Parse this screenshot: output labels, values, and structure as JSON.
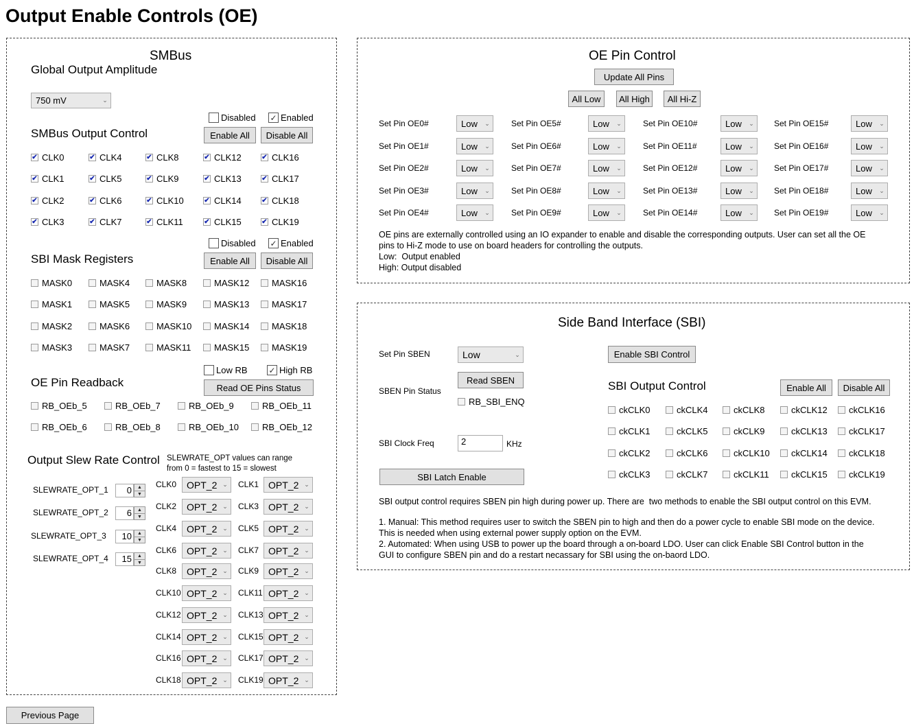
{
  "page_title": "Output Enable Controls (OE)",
  "smbus": {
    "title": "SMBus",
    "global_amp_label": "Global Output Amplitude",
    "global_amp_value": "750 mV",
    "output_control": {
      "title": "SMBus Output Control",
      "disabled_label": "Disabled",
      "enabled_label": "Enabled",
      "disabled_checked": false,
      "enabled_checked": true,
      "enable_all": "Enable All",
      "disable_all": "Disable All",
      "columns": [
        [
          "CLK0",
          "CLK1",
          "CLK2",
          "CLK3"
        ],
        [
          "CLK4",
          "CLK5",
          "CLK6",
          "CLK7"
        ],
        [
          "CLK8",
          "CLK9",
          "CLK10",
          "CLK11"
        ],
        [
          "CLK12",
          "CLK13",
          "CLK14",
          "CLK15"
        ],
        [
          "CLK16",
          "CLK17",
          "CLK18",
          "CLK19"
        ]
      ],
      "all_checked": true
    },
    "mask": {
      "title": "SBI Mask Registers",
      "disabled_label": "Disabled",
      "enabled_label": "Enabled",
      "disabled_checked": false,
      "enabled_checked": true,
      "enable_all": "Enable All",
      "disable_all": "Disable All",
      "columns": [
        [
          "MASK0",
          "MASK1",
          "MASK2",
          "MASK3"
        ],
        [
          "MASK4",
          "MASK5",
          "MASK6",
          "MASK7"
        ],
        [
          "MASK8",
          "MASK9",
          "MASK10",
          "MASK11"
        ],
        [
          "MASK12",
          "MASK13",
          "MASK14",
          "MASK15"
        ],
        [
          "MASK16",
          "MASK17",
          "MASK18",
          "MASK19"
        ]
      ],
      "all_checked": false
    },
    "readback": {
      "title": "OE Pin Readback",
      "low_rb_label": "Low RB",
      "high_rb_label": "High RB",
      "low_rb_checked": false,
      "high_rb_checked": true,
      "read_button": "Read OE Pins Status",
      "columns": [
        [
          "RB_OEb_5",
          "RB_OEb_6"
        ],
        [
          "RB_OEb_7",
          "RB_OEb_8"
        ],
        [
          "RB_OEb_9",
          "RB_OEb_10"
        ],
        [
          "RB_OEb_11",
          "RB_OEb_12"
        ]
      ]
    },
    "slew": {
      "title": "Output Slew Rate Control",
      "note_line1": "SLEWRATE_OPT values can range",
      "note_line2": "from 0 = fastest to 15 = slowest",
      "options": [
        {
          "label": "SLEWRATE_OPT_1",
          "value": "0"
        },
        {
          "label": "SLEWRATE_OPT_2",
          "value": "6"
        },
        {
          "label": "SLEWRATE_OPT_3",
          "value": "10"
        },
        {
          "label": "SLEWRATE_OPT_4",
          "value": "15"
        }
      ],
      "clocks": [
        {
          "label": "CLK0",
          "value": "OPT_2"
        },
        {
          "label": "CLK1",
          "value": "OPT_2"
        },
        {
          "label": "CLK2",
          "value": "OPT_2"
        },
        {
          "label": "CLK3",
          "value": "OPT_2"
        },
        {
          "label": "CLK4",
          "value": "OPT_2"
        },
        {
          "label": "CLK5",
          "value": "OPT_2"
        },
        {
          "label": "CLK6",
          "value": "OPT_2"
        },
        {
          "label": "CLK7",
          "value": "OPT_2"
        },
        {
          "label": "CLK8",
          "value": "OPT_2"
        },
        {
          "label": "CLK9",
          "value": "OPT_2"
        },
        {
          "label": "CLK10",
          "value": "OPT_2"
        },
        {
          "label": "CLK11",
          "value": "OPT_2"
        },
        {
          "label": "CLK12",
          "value": "OPT_2"
        },
        {
          "label": "CLK13",
          "value": "OPT_2"
        },
        {
          "label": "CLK14",
          "value": "OPT_2"
        },
        {
          "label": "CLK15",
          "value": "OPT_2"
        },
        {
          "label": "CLK16",
          "value": "OPT_2"
        },
        {
          "label": "CLK17",
          "value": "OPT_2"
        },
        {
          "label": "CLK18",
          "value": "OPT_2"
        },
        {
          "label": "CLK19",
          "value": "OPT_2"
        }
      ]
    }
  },
  "oe_pin": {
    "title": "OE Pin Control",
    "update_all": "Update All Pins",
    "all_low": "All Low",
    "all_high": "All High",
    "all_hiz": "All Hi-Z",
    "pins": [
      {
        "label": "Set Pin OE0#",
        "value": "Low"
      },
      {
        "label": "Set Pin OE1#",
        "value": "Low"
      },
      {
        "label": "Set Pin OE2#",
        "value": "Low"
      },
      {
        "label": "Set Pin OE3#",
        "value": "Low"
      },
      {
        "label": "Set Pin OE4#",
        "value": "Low"
      },
      {
        "label": "Set Pin OE5#",
        "value": "Low"
      },
      {
        "label": "Set Pin OE6#",
        "value": "Low"
      },
      {
        "label": "Set Pin OE7#",
        "value": "Low"
      },
      {
        "label": "Set Pin OE8#",
        "value": "Low"
      },
      {
        "label": "Set Pin OE9#",
        "value": "Low"
      },
      {
        "label": "Set Pin OE10#",
        "value": "Low"
      },
      {
        "label": "Set Pin OE11#",
        "value": "Low"
      },
      {
        "label": "Set Pin OE12#",
        "value": "Low"
      },
      {
        "label": "Set Pin OE13#",
        "value": "Low"
      },
      {
        "label": "Set Pin OE14#",
        "value": "Low"
      },
      {
        "label": "Set Pin OE15#",
        "value": "Low"
      },
      {
        "label": "Set Pin OE16#",
        "value": "Low"
      },
      {
        "label": "Set Pin OE17#",
        "value": "Low"
      },
      {
        "label": "Set Pin OE18#",
        "value": "Low"
      },
      {
        "label": "Set Pin OE19#",
        "value": "Low"
      }
    ],
    "desc_line1": "OE pins are externally controlled using an IO expander to enable and disable the corresponding outputs. User can set all the OE",
    "desc_line2": "pins to Hi-Z mode to use on board headers for controlling the outputs.",
    "desc_line3": "Low:  Output enabled",
    "desc_line4": "High: Output disabled"
  },
  "sbi": {
    "title": "Side Band Interface (SBI)",
    "set_pin_label": "Set Pin SBEN",
    "set_pin_value": "Low",
    "status_label": "SBEN Pin Status",
    "read_button": "Read SBEN",
    "rb_label": "RB_SBI_ENQ",
    "freq_label": "SBI Clock Freq",
    "freq_value": "2",
    "freq_unit": "KHz",
    "latch_button": "SBI Latch Enable",
    "enable_control_button": "Enable SBI Control",
    "output_title": "SBI Output Control",
    "enable_all": "Enable All",
    "disable_all": "Disable All",
    "columns": [
      [
        "ckCLK0",
        "ckCLK1",
        "ckCLK2",
        "ckCLK3"
      ],
      [
        "ckCLK4",
        "ckCLK5",
        "ckCLK6",
        "ckCLK7"
      ],
      [
        "ckCLK8",
        "ckCLK9",
        "ckCLK10",
        "ckCLK11"
      ],
      [
        "ckCLK12",
        "ckCLK13",
        "ckCLK14",
        "ckCLK15"
      ],
      [
        "ckCLK16",
        "ckCLK17",
        "ckCLK18",
        "ckCLK19"
      ]
    ],
    "desc_line1": "SBI output control requires SBEN pin high during power up. There are  two methods to enable the SBI output control on this EVM.",
    "desc_line2": "1. Manual: This method requires user to switch the SBEN pin to high and then do a power cycle to enable SBI mode on the device.",
    "desc_line3": "This is needed when using external power supply option on the EVM.",
    "desc_line4": "2. Automated: When using USB to power up the board through a on-board LDO. User can click Enable SBI Control button in the",
    "desc_line5": "GUI to configure SBEN pin and do a restart necassary for SBI using the on-baord LDO."
  },
  "footer": {
    "previous_page": "Previous Page"
  }
}
